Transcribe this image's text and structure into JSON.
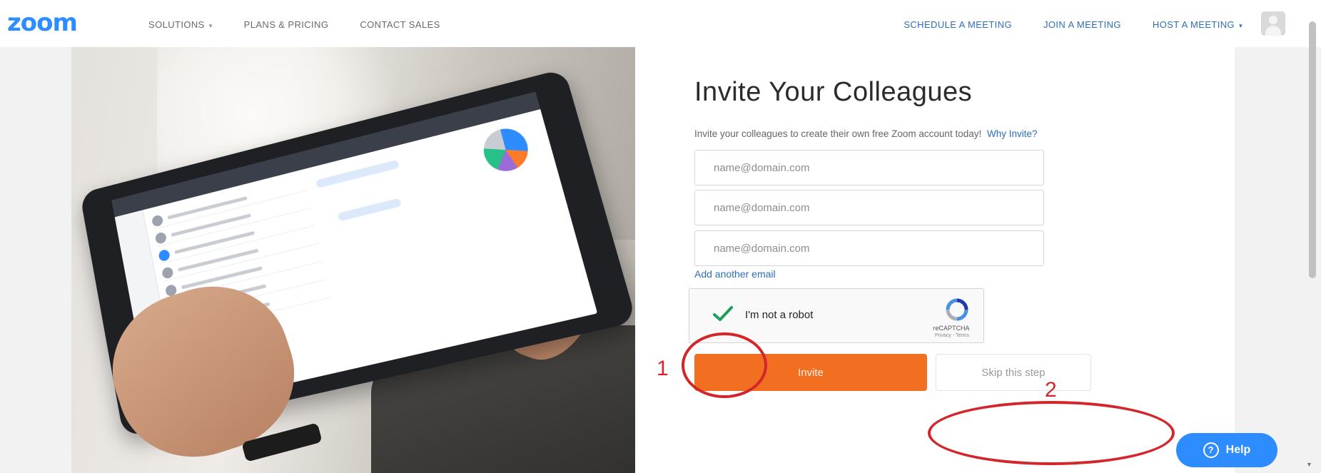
{
  "header": {
    "logo": "zoom",
    "nav_left": [
      {
        "label": "SOLUTIONS",
        "has_caret": true
      },
      {
        "label": "PLANS & PRICING",
        "has_caret": false
      },
      {
        "label": "CONTACT SALES",
        "has_caret": false
      }
    ],
    "nav_right": [
      {
        "label": "SCHEDULE A MEETING",
        "has_caret": false
      },
      {
        "label": "JOIN A MEETING",
        "has_caret": false
      },
      {
        "label": "HOST A MEETING",
        "has_caret": true
      }
    ],
    "caret_glyph": "▾"
  },
  "main": {
    "title": "Invite Your Colleagues",
    "subtitle": "Invite your colleagues to create their own free Zoom account today!",
    "why_link": "Why Invite?",
    "email_fields": [
      {
        "placeholder": "name@domain.com",
        "value": ""
      },
      {
        "placeholder": "name@domain.com",
        "value": ""
      },
      {
        "placeholder": "name@domain.com",
        "value": ""
      }
    ],
    "add_email": "Add another email",
    "captcha": {
      "label": "I'm not a robot",
      "checked": true,
      "brand": "reCAPTCHA",
      "links": "Privacy - Terms"
    },
    "invite_label": "Invite",
    "skip_label": "Skip this step"
  },
  "annotations": {
    "marker_1": "1",
    "marker_2": "2",
    "color": "#d2262b"
  },
  "help": {
    "label": "Help",
    "icon": "?"
  },
  "colors": {
    "brand_blue": "#2d8cff",
    "link_blue": "#2d6eb5",
    "invite_orange": "#f26f21",
    "check_green": "#1e9e5a"
  }
}
